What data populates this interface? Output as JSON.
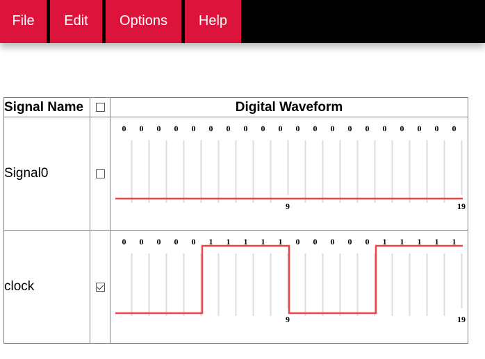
{
  "menu": {
    "file": "File",
    "edit": "Edit",
    "options": "Options",
    "help": "Help"
  },
  "table": {
    "header_name": "Signal Name",
    "header_waveform": "Digital Waveform",
    "header_checkbox_checked": false
  },
  "signals": [
    {
      "name": "Signal0",
      "checked": false,
      "bits": [
        0,
        0,
        0,
        0,
        0,
        0,
        0,
        0,
        0,
        0,
        0,
        0,
        0,
        0,
        0,
        0,
        0,
        0,
        0,
        0
      ],
      "tick_labels": [
        {
          "index": 9,
          "label": "9"
        },
        {
          "index": 19,
          "label": "19"
        }
      ]
    },
    {
      "name": "clock",
      "checked": true,
      "bits": [
        0,
        0,
        0,
        0,
        0,
        1,
        1,
        1,
        1,
        1,
        0,
        0,
        0,
        0,
        0,
        1,
        1,
        1,
        1,
        1
      ],
      "tick_labels": [
        {
          "index": 9,
          "label": "9"
        },
        {
          "index": 19,
          "label": "19"
        }
      ]
    }
  ],
  "colors": {
    "menu_bg": "#000000",
    "menu_item": "#dc143c",
    "waveform_line": "#ee4444",
    "grid_line": "#dddddd"
  }
}
